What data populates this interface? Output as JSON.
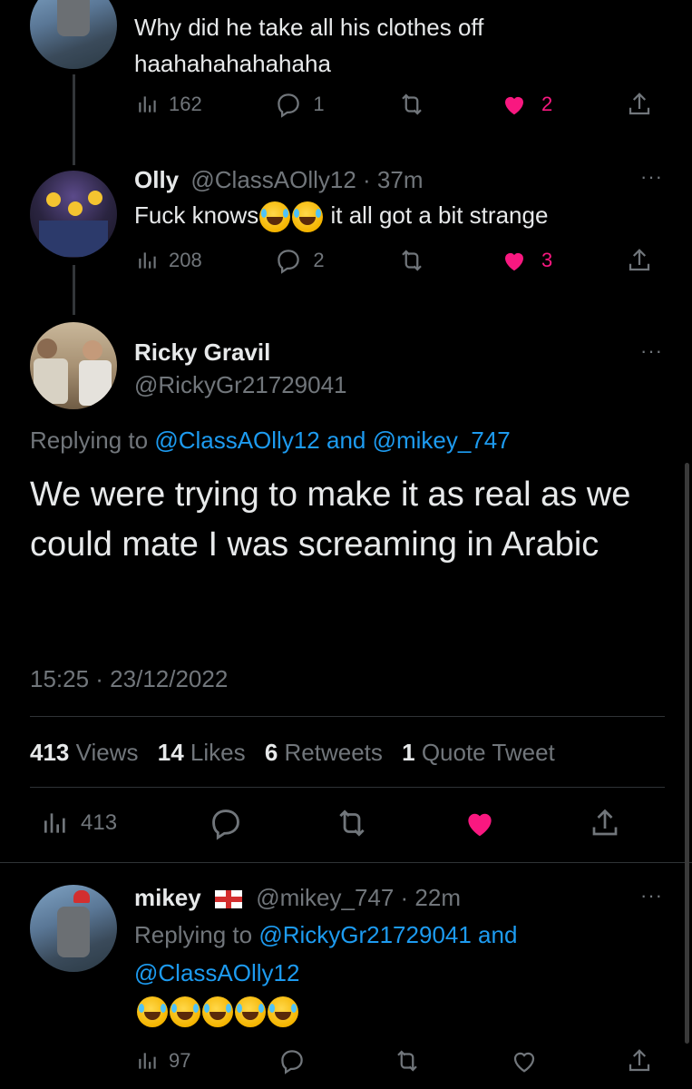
{
  "tweet1": {
    "text_line1": "Why did he take all his clothes off",
    "text_line2": "haahahahahahaha",
    "views": "162",
    "replies": "1",
    "likes": "2"
  },
  "tweet2": {
    "name": "Olly",
    "handle_time": "@ClassAOlly12 · 37m",
    "text_before": "Fuck knows",
    "text_after": " it all got a bit strange",
    "views": "208",
    "replies": "2",
    "likes": "3"
  },
  "main_tweet": {
    "name": "Ricky Gravil",
    "handle": "@RickyGr21729041",
    "replying_prefix": "Replying to ",
    "replying_user1": "@ClassAOlly12",
    "replying_and": " and ",
    "replying_user2": "@mikey_747",
    "text": "We were trying to make it as real as we could mate I was screaming in Arabic",
    "timestamp": "15:25 · 23/12/2022",
    "stats": {
      "views_count": "413",
      "views_label": " Views",
      "likes_count": "14",
      "likes_label": " Likes",
      "retweets_count": "6",
      "retweets_label": " Retweets",
      "quotes_count": "1",
      "quotes_label": " Quote Tweet"
    },
    "action_views": "413"
  },
  "reply": {
    "name": "mikey",
    "flag": "🏴",
    "handle_time": "@mikey_747 · 22m",
    "replying_prefix": "Replying to ",
    "replying_user1": "@RickyGr21729041",
    "replying_and": " and",
    "replying_user2": "@ClassAOlly12",
    "views": "97"
  },
  "more_label": "···",
  "colors": {
    "like_pink": "#f91880",
    "link_blue": "#1d9bf0",
    "muted": "#71767b"
  }
}
